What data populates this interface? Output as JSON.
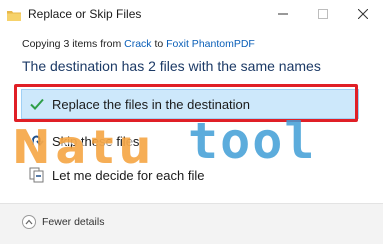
{
  "window": {
    "title": "Replace or Skip Files",
    "controls": {
      "minimize": "minimize",
      "maximize": "maximize",
      "close": "close"
    }
  },
  "progress": {
    "prefix": "Copying 3 items from ",
    "source": "Crack",
    "middle": " to ",
    "destination": "Foxit PhantomPDF"
  },
  "headline": "The destination has 2 files with the same names",
  "options": [
    {
      "label": "Replace the files in the destination",
      "icon": "checkmark-icon",
      "selected": true
    },
    {
      "label": "Skip these files",
      "icon": "skip-arrow-icon",
      "selected": false
    },
    {
      "label": "Let me decide for each file",
      "icon": "decide-files-icon",
      "selected": false
    }
  ],
  "footer": {
    "details_toggle": "Fewer details"
  },
  "watermark": {
    "part1": "Natu",
    "part2": "tool"
  },
  "colors": {
    "accent_link": "#0a5fb8",
    "headline": "#1c3a66",
    "selection_bg": "#cde8fb",
    "highlight_border": "#e01f26",
    "check_green": "#2e9e48",
    "watermark_orange": "#f4a038",
    "watermark_blue": "#409dd6"
  }
}
